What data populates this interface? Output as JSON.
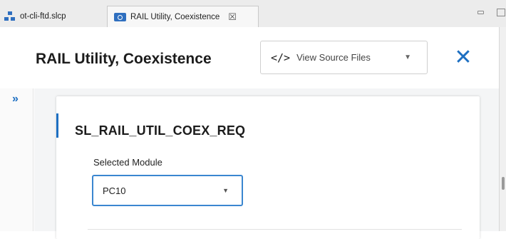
{
  "tabs": [
    {
      "label": "ot-cli-ftd.slcp",
      "icon": "project-icon"
    },
    {
      "label": "RAIL Utility, Coexistence",
      "icon": "config-icon",
      "close": "☒",
      "active": true
    }
  ],
  "header": {
    "title": "RAIL Utility, Coexistence",
    "source_button": {
      "icon": "</>",
      "label": "View Source Files",
      "caret": "▼"
    },
    "close": "✕"
  },
  "sidebar": {
    "expand": "»"
  },
  "card": {
    "title": "SL_RAIL_UTIL_COEX_REQ",
    "field_label": "Selected Module",
    "select": {
      "value": "PC10",
      "caret": "▼"
    }
  },
  "colors": {
    "accent": "#1d6fc2",
    "tab_icon": "#2f6fbf"
  }
}
